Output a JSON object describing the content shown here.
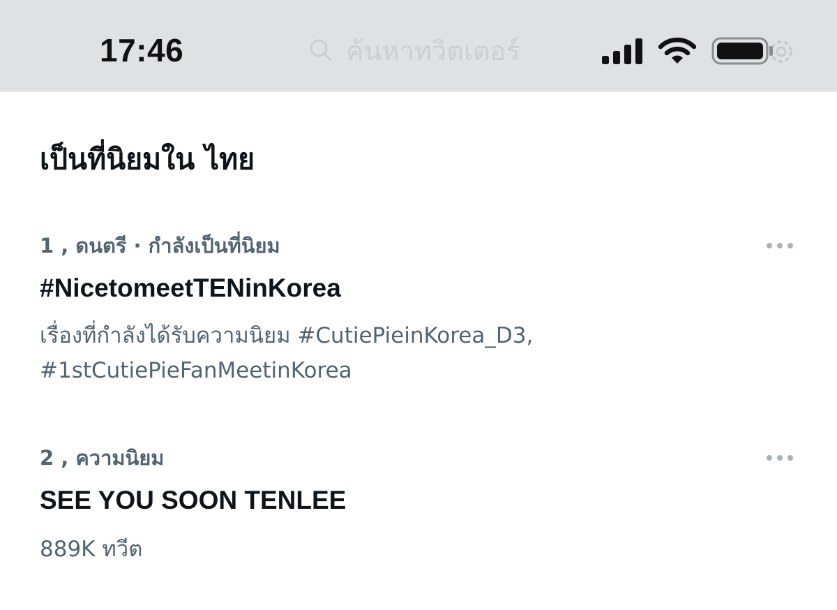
{
  "status_bar": {
    "time": "17:46",
    "ghost_search_placeholder": "ค้นหาทวิตเตอร์",
    "icons": [
      "signal-icon",
      "wifi-icon",
      "battery-icon"
    ]
  },
  "section": {
    "title": "เป็นที่นิยมใน ไทย"
  },
  "trends": [
    {
      "meta": "1 , ดนตรี · กำลังเป็นที่นิยม",
      "name": "#NicetomeetTENinKorea",
      "context_line1": "เรื่องที่กำลังได้รับความนิยม #CutiePieinKorea_D3,",
      "context_line2": "#1stCutiePieFanMeetinKorea"
    },
    {
      "meta": "2 , ความนิยม",
      "name": "SEE YOU SOON TENLEE",
      "count": "889K ทวีต"
    }
  ],
  "colors": {
    "status_bar_bg": "#dfe1e3",
    "text_primary": "#0f1419",
    "text_secondary": "#536471"
  }
}
